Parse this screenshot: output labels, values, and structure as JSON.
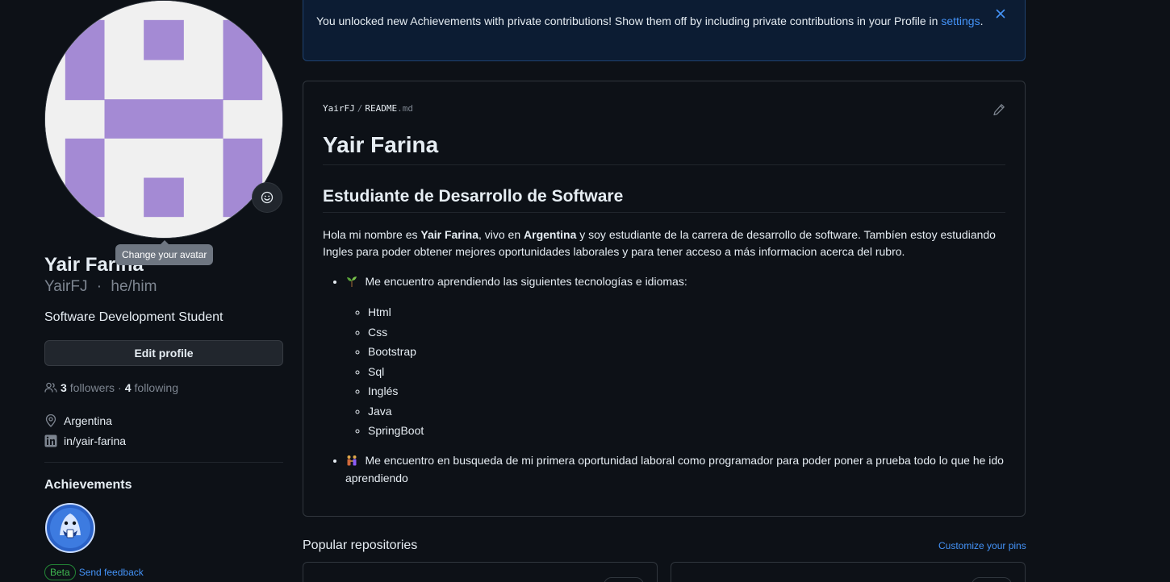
{
  "profile": {
    "full_name": "Yair Farina",
    "username": "YairFJ",
    "pronouns_sep": "·",
    "pronouns": "he/him",
    "bio": "Software Development Student",
    "edit_label": "Edit profile",
    "tooltip": "Change your avatar",
    "followers_count": "3",
    "followers_label": "followers",
    "following_count": "4",
    "following_label": "following",
    "location": "Argentina",
    "linkedin": "in/yair-farina"
  },
  "achievements": {
    "title": "Achievements",
    "beta_label": "Beta",
    "feedback_label": "Send feedback"
  },
  "flash": {
    "message": "You unlocked new Achievements with private contributions! Show them off by including private contributions in your Profile in",
    "link": "settings",
    "end": "."
  },
  "readme": {
    "owner": "YairFJ",
    "sep": "/",
    "file": "README",
    "ext": ".md",
    "h1": "Yair Farina",
    "h2": "Estudiante de Desarrollo de Software",
    "p_1": "Hola mi nombre es ",
    "p_bold_name": "Yair Farina",
    "p_2": ", vivo en ",
    "p_bold_country": "Argentina",
    "p_3": " y soy estudiante de la carrera de desarrollo de software. Tambíen estoy estudiando Ingles para poder obtener mejores oportunidades laborales y para tener acceso a más informacion acerca del rubro.",
    "bullet_1": "Me encuentro aprendiendo las siguientes tecnologías e idiomas:",
    "techs": [
      "Html",
      "Css",
      "Bootstrap",
      "Sql",
      "Inglés",
      "Java",
      "SpringBoot"
    ],
    "bullet_2": "Me encuentro en busqueda de mi primera oportunidad laboral como programador para poder poner a prueba todo lo que he ido aprendiendo"
  },
  "repos": {
    "title": "Popular repositories",
    "customize": "Customize your pins"
  },
  "colors": {
    "background": "#0d1117",
    "avatar_purple": "#a48ad4",
    "link": "#4493f8"
  }
}
